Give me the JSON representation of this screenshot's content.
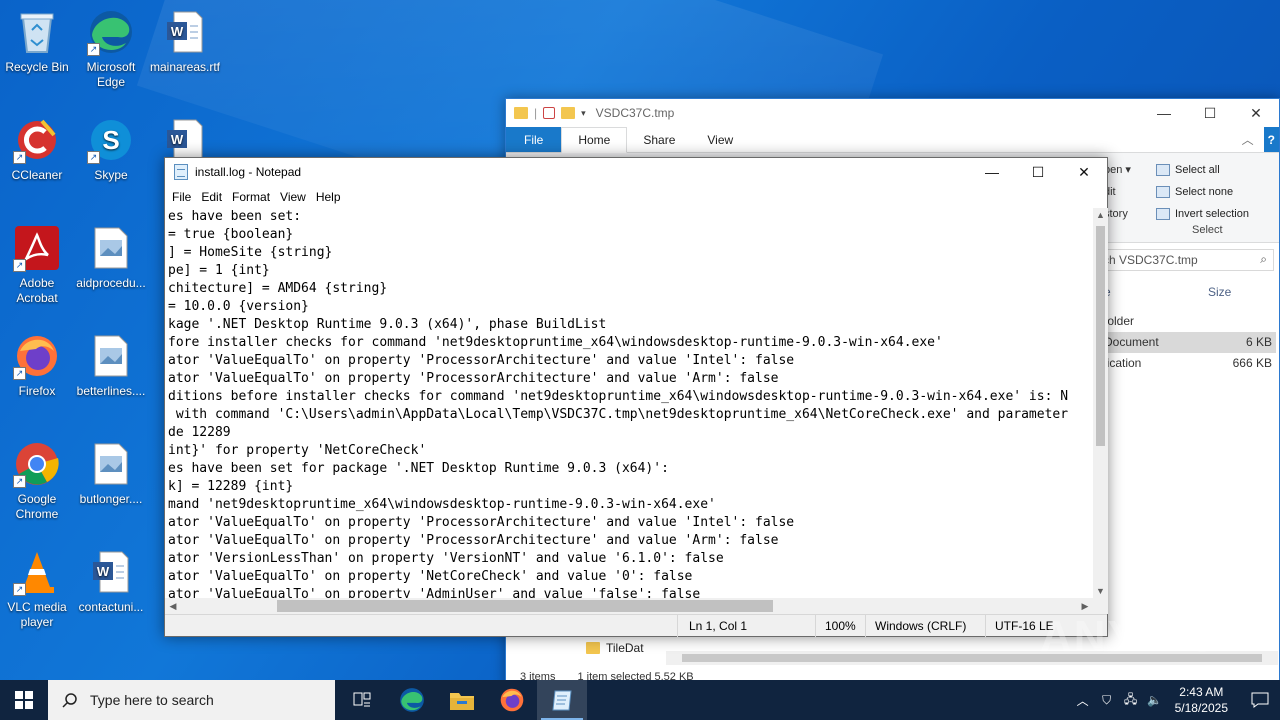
{
  "desktop_icons": [
    {
      "label": "Recycle Bin"
    },
    {
      "label": "Microsoft Edge"
    },
    {
      "label": "mainareas.rtf"
    },
    {
      "label": "CCleaner"
    },
    {
      "label": "Skype"
    },
    {
      "label": "Adobe Acrobat"
    },
    {
      "label": "aidprocedu..."
    },
    {
      "label": "Firefox"
    },
    {
      "label": "betterlines...."
    },
    {
      "label": "Google Chrome"
    },
    {
      "label": "butlonger...."
    },
    {
      "label": "VLC media player"
    },
    {
      "label": "contactuni..."
    }
  ],
  "explorer": {
    "title": "VSDC37C.tmp",
    "tabs": [
      "File",
      "Home",
      "Share",
      "View"
    ],
    "ribbon_left": [
      "pen ▾",
      "dit",
      "story"
    ],
    "select_group": {
      "items": [
        "Select all",
        "Select none",
        "Invert selection"
      ],
      "label": "Select"
    },
    "search_placeholder": "ch VSDC37C.tmp",
    "column_name": "e",
    "column_size": "Size",
    "rows": [
      {
        "name": "folder",
        "size": ""
      },
      {
        "name": "Document",
        "size": "6 KB"
      },
      {
        "name": "lication",
        "size": "666 KB"
      }
    ],
    "tiledata_label": "TileDat",
    "status": {
      "items": "3 items",
      "selected": "1 item selected  5.52 KB"
    }
  },
  "notepad": {
    "title": "install.log - Notepad",
    "menu": [
      "File",
      "Edit",
      "Format",
      "View",
      "Help"
    ],
    "lines": [
      "es have been set:",
      "= true {boolean}",
      "] = HomeSite {string}",
      "pe] = 1 {int}",
      "chitecture] = AMD64 {string}",
      "= 10.0.0 {version}",
      "kage '.NET Desktop Runtime 9.0.3 (x64)', phase BuildList",
      "fore installer checks for command 'net9desktopruntime_x64\\windowsdesktop-runtime-9.0.3-win-x64.exe'",
      "ator 'ValueEqualTo' on property 'ProcessorArchitecture' and value 'Intel': false",
      "ator 'ValueEqualTo' on property 'ProcessorArchitecture' and value 'Arm': false",
      "ditions before installer checks for command 'net9desktopruntime_x64\\windowsdesktop-runtime-9.0.3-win-x64.exe' is: N",
      " with command 'C:\\Users\\admin\\AppData\\Local\\Temp\\VSDC37C.tmp\\net9desktopruntime_x64\\NetCoreCheck.exe' and parameter",
      "de 12289",
      "int}' for property 'NetCoreCheck'",
      "es have been set for package '.NET Desktop Runtime 9.0.3 (x64)':",
      "k] = 12289 {int}",
      "mand 'net9desktopruntime_x64\\windowsdesktop-runtime-9.0.3-win-x64.exe'",
      "ator 'ValueEqualTo' on property 'ProcessorArchitecture' and value 'Intel': false",
      "ator 'ValueEqualTo' on property 'ProcessorArchitecture' and value 'Arm': false",
      "ator 'VersionLessThan' on property 'VersionNT' and value '6.1.0': false",
      "ator 'ValueEqualTo' on property 'NetCoreCheck' and value '0': false",
      "ator 'ValueEqualTo' on property 'AdminUser' and value 'false': false"
    ],
    "status": {
      "position": "Ln 1, Col 1",
      "zoom": "100%",
      "line_ending": "Windows (CRLF)",
      "encoding": "UTF-16 LE"
    }
  },
  "taskbar": {
    "search_placeholder": "Type here to search",
    "time": "2:43 AM",
    "date": "5/18/2025"
  },
  "watermark": "ANY RUN"
}
